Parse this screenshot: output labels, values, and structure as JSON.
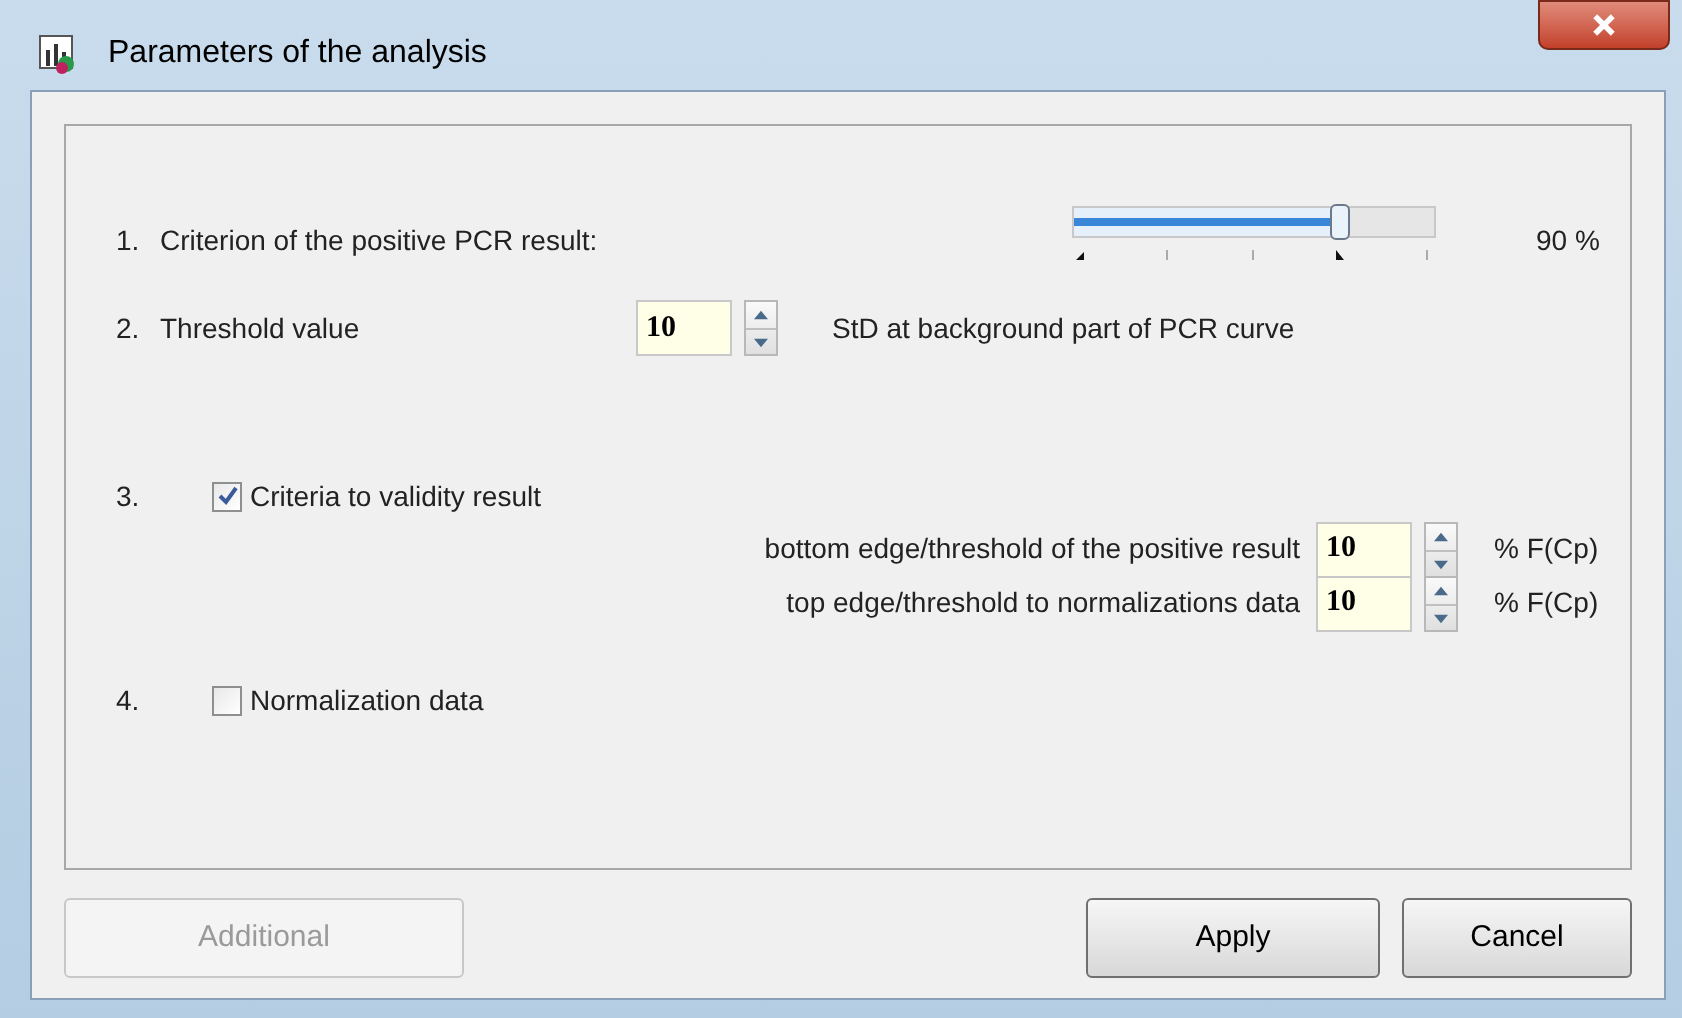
{
  "window": {
    "title": "Parameters of the analysis"
  },
  "criterion": {
    "number": "1.",
    "label": "Criterion of the positive PCR result:",
    "level": 0.74,
    "reading": "90 %"
  },
  "threshold": {
    "number": "2.",
    "label": "Threshold value",
    "value": "10",
    "unit": "StD at background part of PCR curve"
  },
  "validity": {
    "number": "3.",
    "label": "Criteria to validity result",
    "checked": true,
    "fields": [
      {
        "label": "bottom edge/threshold of the positive result",
        "value": "10",
        "unit": "% F(Cp)"
      },
      {
        "label": "top edge/threshold to normalizations data",
        "value": "10",
        "unit": "% F(Cp)"
      }
    ]
  },
  "normalization": {
    "number": "4.",
    "label": "Normalization data",
    "checked": false
  },
  "buttons": [
    {
      "label": "Additional",
      "disabled": true
    },
    {
      "label": "Apply",
      "disabled": false
    },
    {
      "label": "Cancel",
      "disabled": false
    }
  ]
}
